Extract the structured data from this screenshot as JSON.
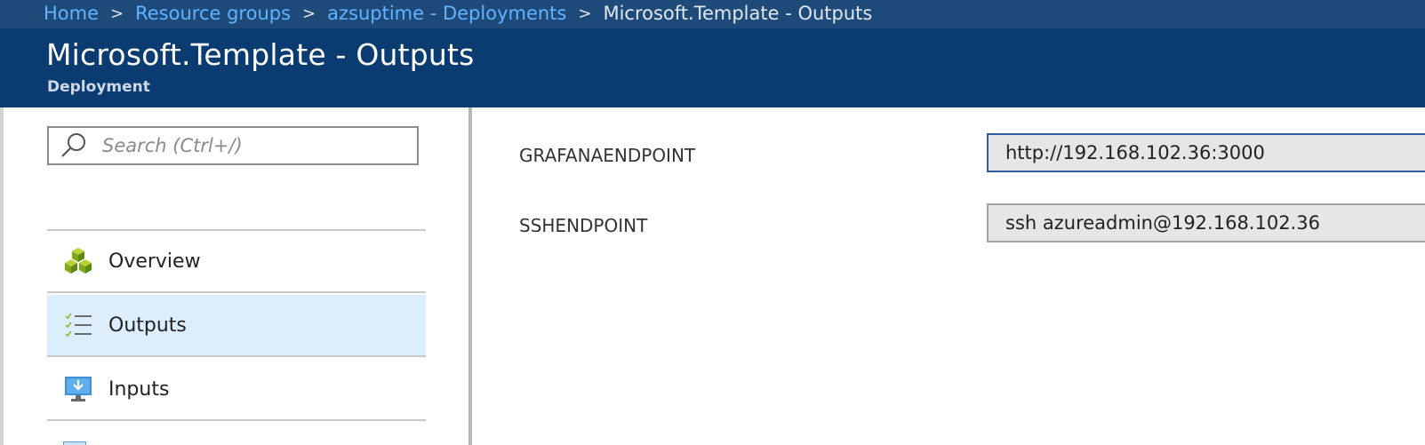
{
  "breadcrumb": {
    "links": [
      "Home",
      "Resource groups",
      "azsuptime - Deployments"
    ],
    "current": "Microsoft.Template - Outputs",
    "separator": ">"
  },
  "header": {
    "title": "Microsoft.Template - Outputs",
    "subtitle": "Deployment"
  },
  "sidebar": {
    "search_placeholder": "Search (Ctrl+/)",
    "items": [
      {
        "label": "Overview",
        "icon": "cubes-icon"
      },
      {
        "label": "Outputs",
        "icon": "checklist-icon",
        "selected": true
      },
      {
        "label": "Inputs",
        "icon": "monitor-download-icon"
      }
    ]
  },
  "outputs": [
    {
      "name": "GRAFANAENDPOINT",
      "value": "http://192.168.102.36:3000"
    },
    {
      "name": "SSHENDPOINT",
      "value": "ssh azureadmin@192.168.102.36"
    }
  ],
  "colors": {
    "breadcrumb_bar": "#1e4a7a",
    "header_bar": "#0a3c72",
    "link": "#62b3ff",
    "selected_item": "#dceefc",
    "focus_border": "#2c5e9e"
  }
}
